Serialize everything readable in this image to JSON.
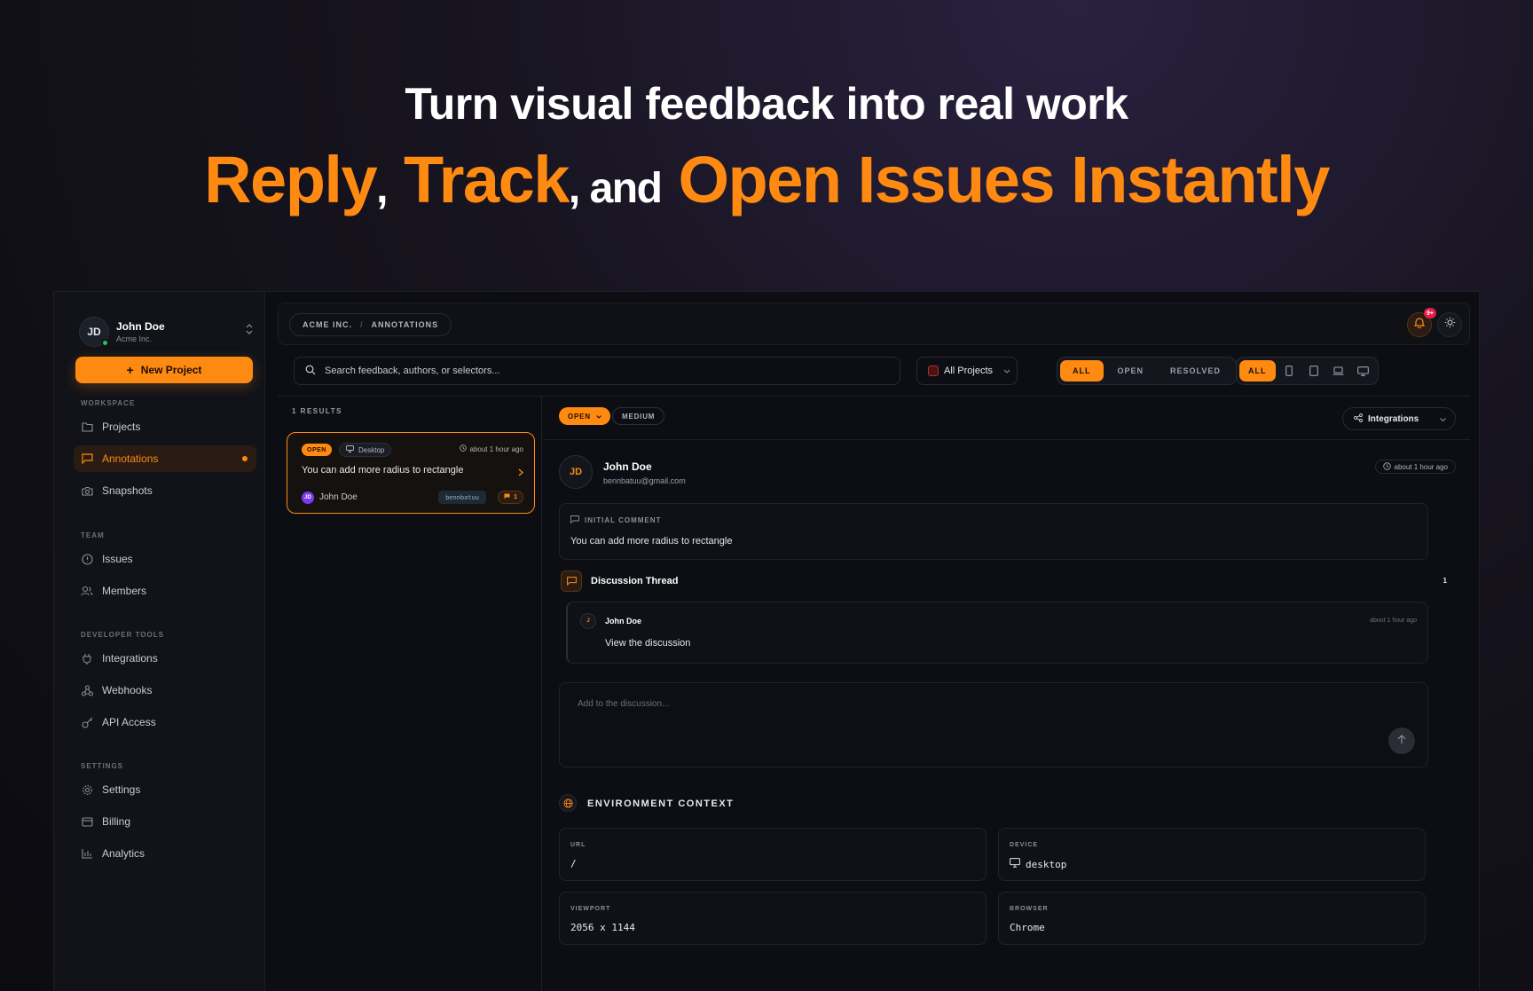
{
  "hero": {
    "line1": "Turn visual feedback into real work",
    "word1": "Reply",
    "comma1": ",",
    "word2": "Track",
    "and": ", and",
    "word3": "Open Issues Instantly"
  },
  "colors": {
    "accent": "#ff8a12",
    "online": "#22c55e",
    "badge": "#e11d48"
  },
  "account": {
    "initials": "JD",
    "name": "John Doe",
    "org": "Acme Inc.",
    "switch_icon": "chevron-updown-icon"
  },
  "new_project_label": "New Project",
  "sidebar": {
    "sections": [
      {
        "label": "WORKSPACE"
      },
      {
        "label": "TEAM"
      },
      {
        "label": "DEVELOPER TOOLS"
      },
      {
        "label": "SETTINGS"
      }
    ],
    "items": [
      {
        "label": "Projects",
        "icon": "folder-icon"
      },
      {
        "label": "Annotations",
        "icon": "message-icon",
        "active": true
      },
      {
        "label": "Snapshots",
        "icon": "camera-icon"
      },
      {
        "label": "Issues",
        "icon": "alert-circle-icon"
      },
      {
        "label": "Members",
        "icon": "users-icon"
      },
      {
        "label": "Integrations",
        "icon": "plug-icon"
      },
      {
        "label": "Webhooks",
        "icon": "webhook-icon"
      },
      {
        "label": "API Access",
        "icon": "key-icon"
      },
      {
        "label": "Settings",
        "icon": "gear-icon"
      },
      {
        "label": "Billing",
        "icon": "credit-card-icon"
      },
      {
        "label": "Analytics",
        "icon": "bar-chart-icon"
      }
    ]
  },
  "breadcrumb": {
    "org": "ACME INC.",
    "sep": "/",
    "page": "ANNOTATIONS"
  },
  "notifications": {
    "badge": "9+"
  },
  "search": {
    "placeholder": "Search feedback, authors, or selectors..."
  },
  "project_filter": {
    "value": "All Projects"
  },
  "status_filter": {
    "options": [
      "ALL",
      "OPEN",
      "RESOLVED"
    ],
    "selected": "ALL"
  },
  "device_filter": {
    "options": [
      "ALL"
    ],
    "icons": [
      "phone-icon",
      "tablet-icon",
      "laptop-icon",
      "monitor-icon"
    ],
    "selected": "ALL"
  },
  "results_label": "1 RESULTS",
  "card": {
    "status": "OPEN",
    "device": "Desktop",
    "time": "about 1 hour ago",
    "title": "You can add more radius to rectangle",
    "author_initials": "JD",
    "author": "John Doe",
    "tag": "bennbatuu",
    "comments": "1"
  },
  "detail": {
    "status": "OPEN",
    "priority": "MEDIUM",
    "integrations_label": "Integrations",
    "author_initials": "JD",
    "author_name": "John Doe",
    "author_email": "bennbatuu@gmail.com",
    "time": "about 1 hour ago",
    "initial_label": "INITIAL COMMENT",
    "initial_text": "You can add more radius to rectangle",
    "thread_title": "Discussion Thread",
    "thread_count": "1",
    "reply": {
      "initials": "J",
      "name": "John Doe",
      "time": "about 1 hour ago",
      "text": "View the discussion"
    },
    "compose_placeholder": "Add to the discussion...",
    "env_title": "ENVIRONMENT CONTEXT",
    "env": [
      {
        "key": "URL",
        "value": "/"
      },
      {
        "key": "DEVICE",
        "value": "desktop"
      },
      {
        "key": "VIEWPORT",
        "value": "2056 x 1144"
      },
      {
        "key": "BROWSER",
        "value": "Chrome"
      }
    ]
  }
}
